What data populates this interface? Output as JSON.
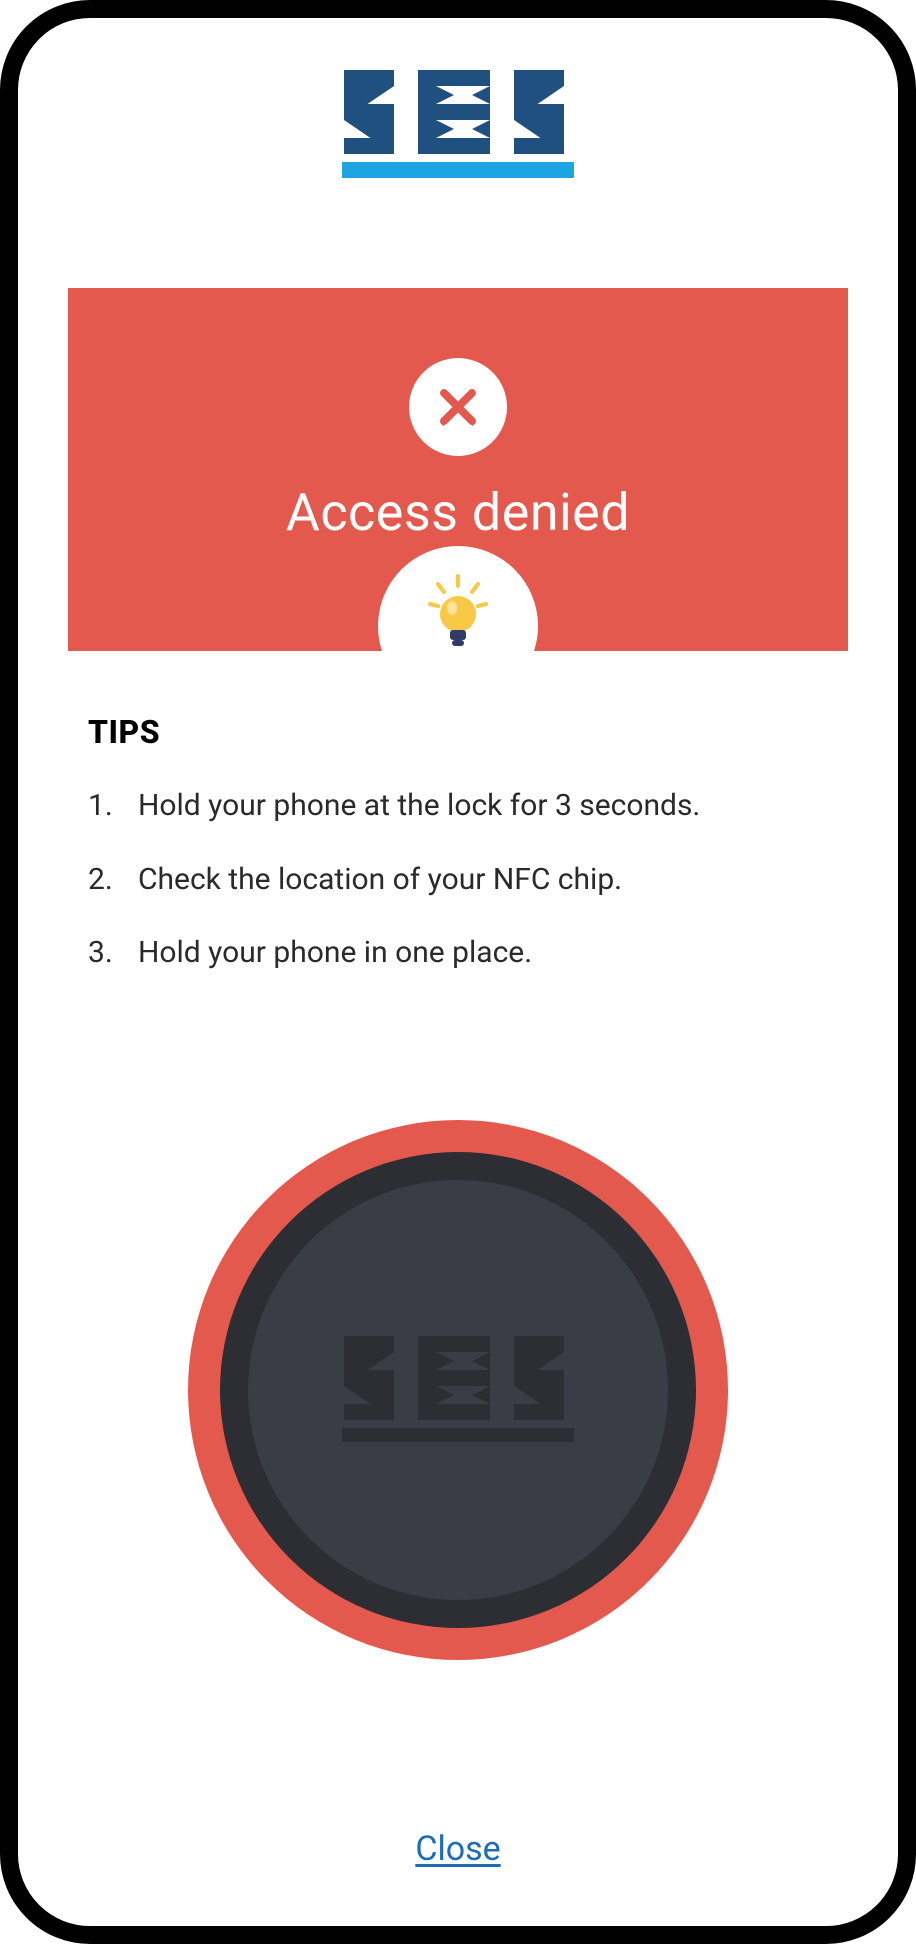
{
  "brand": {
    "name": "sbs",
    "logo_colors": {
      "dark": "#1f5080",
      "underline": "#1ea4e0"
    }
  },
  "alert": {
    "title": "Access denied",
    "icon_semantic": "error-x",
    "bg_color": "#e4594e"
  },
  "tips": {
    "heading": "TIPS",
    "items": [
      "Hold your phone at the lock for 3 seconds.",
      "Check the location of your NFC chip.",
      "Hold your phone in one place."
    ],
    "icon_semantic": "lightbulb-idea"
  },
  "disc": {
    "logo_text": "sbs",
    "colors": {
      "outer": "#e4594e",
      "ring": "#2c2e34",
      "face": "#3a3d45",
      "logo": "#2c2e34"
    }
  },
  "actions": {
    "close_label": "Close"
  }
}
